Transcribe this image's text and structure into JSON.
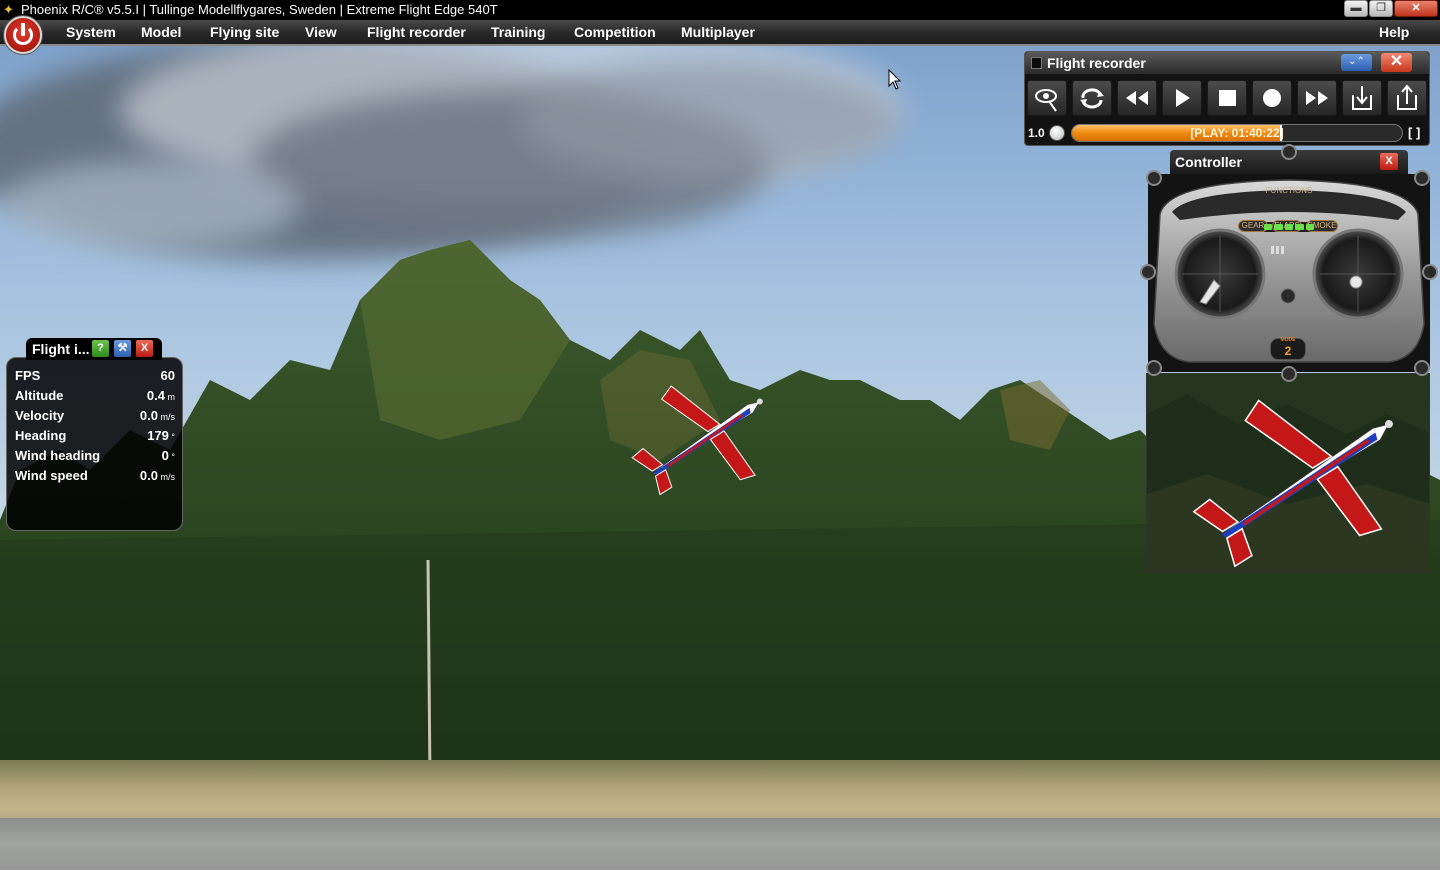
{
  "window": {
    "title": "Phoenix R/C® v5.5.I  |  Tullinge Modellflygares, Sweden  |  Extreme Flight Edge 540T",
    "app_icon": "phoenix-icon",
    "controls": {
      "minimize": "▬",
      "maximize": "❐",
      "close": "✕"
    }
  },
  "menu": {
    "items": [
      "System",
      "Model",
      "Flying site",
      "View",
      "Flight recorder",
      "Training",
      "Competition",
      "Multiplayer"
    ],
    "help": "Help",
    "power_icon": "power-icon"
  },
  "flight_recorder": {
    "title": "Flight recorder",
    "collapse_icon": "double-chevron-down-icon",
    "close_icon": "close-icon",
    "tools": [
      {
        "name": "view-icon",
        "glyph": "👁"
      },
      {
        "name": "loop-icon",
        "glyph": "⟳"
      },
      {
        "name": "rewind-icon",
        "glyph": "◀◀"
      },
      {
        "name": "play-icon",
        "glyph": "▶"
      },
      {
        "name": "stop-icon",
        "glyph": "■"
      },
      {
        "name": "record-icon",
        "glyph": "●"
      },
      {
        "name": "fast-forward-icon",
        "glyph": "▶▶"
      },
      {
        "name": "load-icon",
        "glyph": "⇓"
      },
      {
        "name": "save-icon",
        "glyph": "⇑"
      }
    ],
    "speed": "1.0",
    "playback_label": "[PLAY: 01:40:22]",
    "progress": 0.63,
    "bracket": "[ ]"
  },
  "flight_info": {
    "tab_title": "Flight i...",
    "help_label": "?",
    "config_icon": "wrench-icon",
    "close_label": "X",
    "rows": [
      {
        "label": "FPS",
        "value": "60",
        "unit": ""
      },
      {
        "label": "Altitude",
        "value": "0.4",
        "unit": " m"
      },
      {
        "label": "Velocity",
        "value": "0.0",
        "unit": " m/s"
      },
      {
        "label": "Heading",
        "value": "179",
        "unit": " °"
      },
      {
        "label": "Wind heading",
        "value": "0",
        "unit": " °"
      },
      {
        "label": "Wind speed",
        "value": "0.0",
        "unit": " m/s"
      }
    ]
  },
  "controller": {
    "title": "Controller",
    "close_label": "X",
    "functions_label": "FUNCTIONS",
    "switches": [
      "GEAR",
      "FLAPS",
      "SMOKE"
    ],
    "mode_label": "MODE",
    "mode_value": "2"
  },
  "colors": {
    "accent_orange": "#f08a12",
    "close_red": "#c9361c",
    "info_blue": "#2c5fb0",
    "help_green": "#3a9a2a"
  }
}
